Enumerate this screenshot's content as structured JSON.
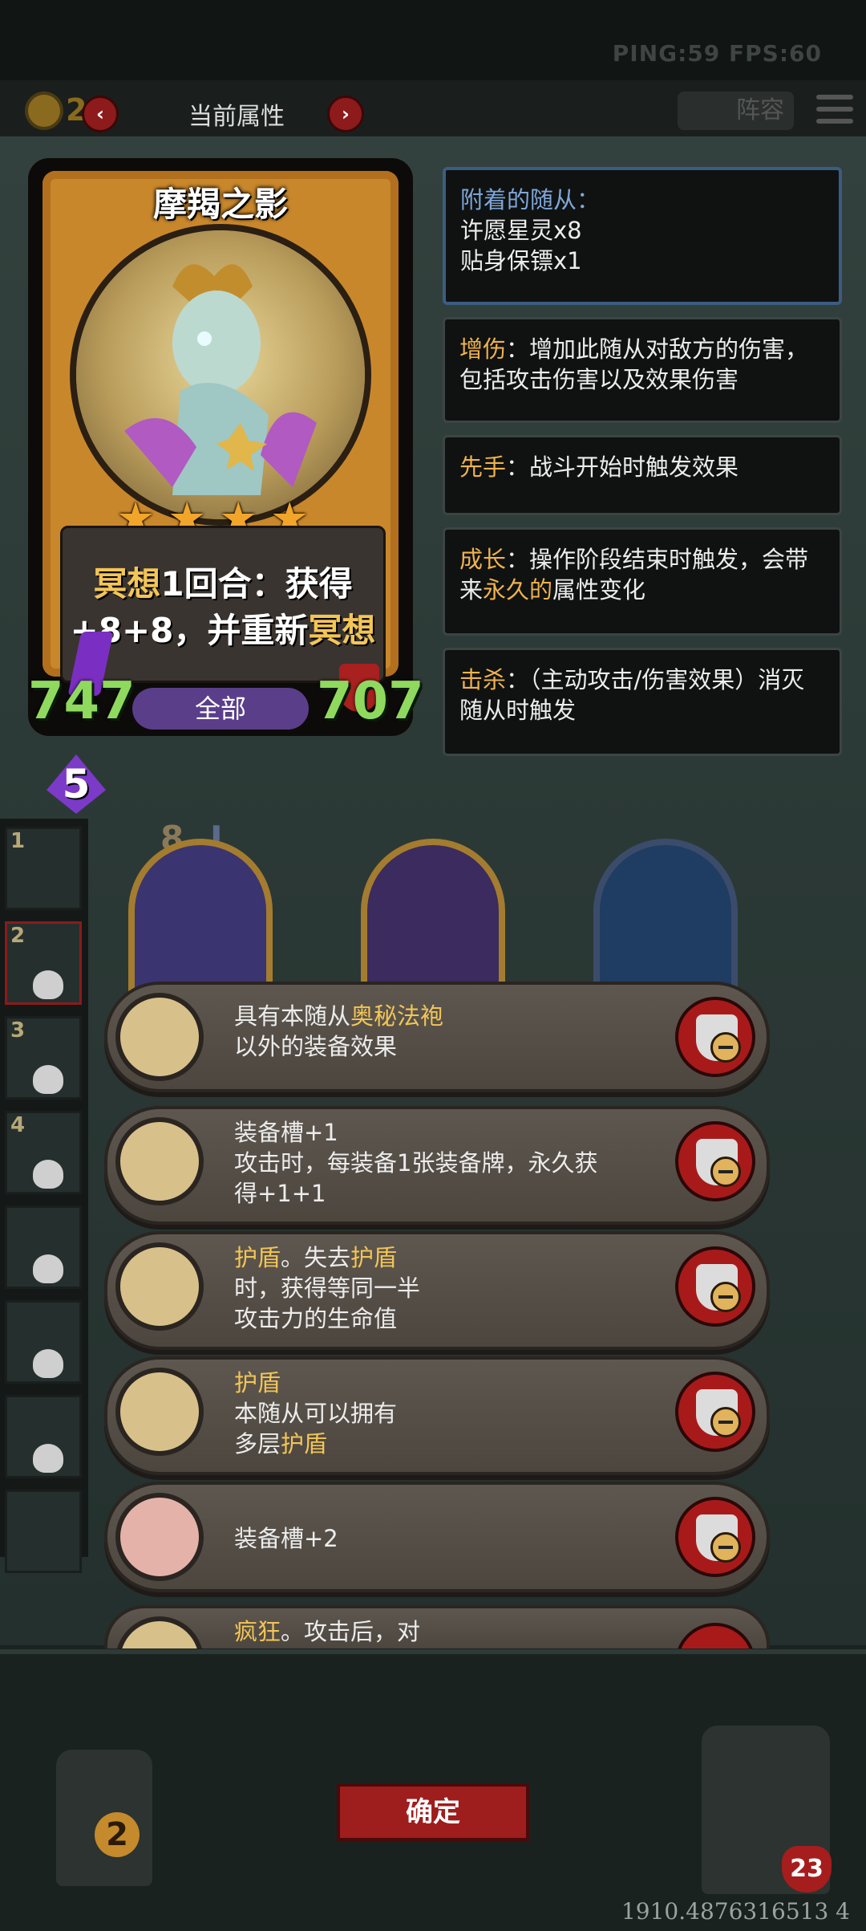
{
  "hud": {
    "ping_fps": "PING:59   FPS:60",
    "coins": "23",
    "screen_title": "当前属性",
    "prev_icon": "chevron-left",
    "next_icon": "chevron-right",
    "lineup_label": "阵容",
    "menu_icon": "hamburger-menu"
  },
  "card": {
    "name": "摩羯之影",
    "stars": 4,
    "ability_line1_key": "冥想",
    "ability_line1_rest": "1回合：获得",
    "ability_line2_main": "+8+8，并重新",
    "ability_line2_key": "冥想",
    "attack": "747",
    "health": "707",
    "tribe": "全部",
    "level": "5"
  },
  "keywords": {
    "attached_title": "附着的随从：",
    "attached_items": [
      "许愿星灵x8",
      "贴身保镖x1"
    ],
    "items": [
      {
        "key": "增伤",
        "sep": "：",
        "desc": "增加此随从对敌方的伤害，包括攻击伤害以及效果伤害"
      },
      {
        "key": "先手",
        "sep": "：",
        "desc": "战斗开始时触发效果"
      },
      {
        "key": "成长",
        "sep": "：",
        "desc_a": "操作阶段结束时触发，会带来",
        "desc_key": "永久的",
        "desc_b": "属性变化"
      },
      {
        "key": "击杀",
        "sep": "：",
        "desc": "（主动攻击/伤害效果）消灭随从时触发"
      }
    ]
  },
  "slots": [
    "1",
    "2",
    "3",
    "4",
    "",
    "",
    "",
    ""
  ],
  "board": {
    "tier_left": "8",
    "tier_mid": "I"
  },
  "equipment": [
    {
      "icon": "robe-icon",
      "l1a": "具有本随从",
      "l1key": "奥秘法袍",
      "l2": "以外的装备效果"
    },
    {
      "icon": "horseshoe-icon",
      "l1": "装备槽+1",
      "l2": "攻击时，每装备1张装备牌，永久获",
      "l3": "得+1+1"
    },
    {
      "icon": "dragon-icon",
      "l1key": "护盾",
      "l1a": "。失去",
      "l1key2": "护盾",
      "l2": "时，获得等同一半",
      "l3": "攻击力的生命值"
    },
    {
      "icon": "mirror-icon",
      "l1key": "护盾",
      "l2": "本随从可以拥有",
      "l3a": "多层",
      "l3key": "护盾"
    },
    {
      "icon": "pig-icon",
      "l1": "装备槽+2"
    },
    {
      "icon": "claw-icon",
      "l1key": "疯狂",
      "l1a": "。攻击后，对"
    }
  ],
  "footer": {
    "confirm_label": "确定",
    "left_token_num": "2",
    "right_token_num": "23",
    "coords": "1910.4876316513 4"
  },
  "colors": {
    "keyword": "#f0b24e",
    "card_frame": "#c9872c",
    "attack_green": "#8fd95e",
    "confirm_red": "#9e1d1d"
  }
}
